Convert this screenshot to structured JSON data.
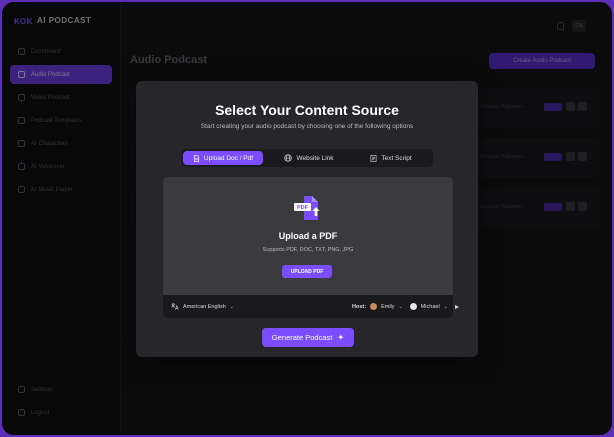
{
  "app": {
    "logo_mark": "ΚΟΚ",
    "logo_text": "AI PODCAST"
  },
  "sidebar": {
    "items": [
      {
        "label": "Dashboard",
        "active": false
      },
      {
        "label": "Audio Podcast",
        "active": true
      },
      {
        "label": "Video Podcast",
        "active": false
      },
      {
        "label": "Podcast Templates",
        "active": false
      },
      {
        "label": "AI Characters",
        "active": false
      },
      {
        "label": "AI Voiceover",
        "active": false
      },
      {
        "label": "AI Music Player",
        "active": false
      }
    ],
    "bottom_items": [
      {
        "label": "Settings"
      },
      {
        "label": "Logout"
      }
    ]
  },
  "header": {
    "avatar_label": "CN"
  },
  "main": {
    "title": "Audio Podcast",
    "create_button": "Create Audio Podcast"
  },
  "background_rows": [
    {
      "text": "Includes 'Welcome..."
    },
    {
      "text": "Includes 'Welcome..."
    },
    {
      "text": "Includes 'Welcome..."
    }
  ],
  "modal": {
    "title": "Select Your Content Source",
    "subtitle": "Start creating your audio podcast by choosing one of the following options",
    "tabs": [
      {
        "label": "Upload Doc / Pdf",
        "icon": "document-icon",
        "active": true
      },
      {
        "label": "Website Link",
        "icon": "globe-icon",
        "active": false
      },
      {
        "label": "Text Script",
        "icon": "text-file-icon",
        "active": false
      }
    ],
    "upload": {
      "icon_label": "PDF",
      "title": "Upload a PDF",
      "supported": "Supports PDF, DOC, TXT, PNG, JPG",
      "button": "UPLOAD PDF"
    },
    "footer": {
      "language": "American English",
      "host_label": "Host:",
      "host1": "Emily",
      "host2": "Michael"
    },
    "generate_button": "Generate Podcast"
  },
  "colors": {
    "accent": "#7c4dff",
    "background": "#141416",
    "modal": "#27272b",
    "frame_border": "#5b2fb8"
  }
}
